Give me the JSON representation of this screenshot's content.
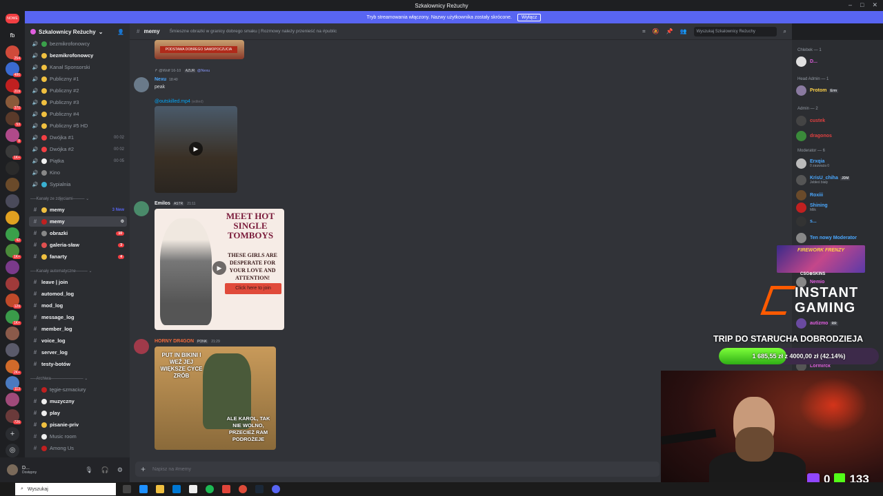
{
  "titlebar": {
    "title": "Szkalownicy Reżuchy"
  },
  "banner": {
    "text": "Tryb streamowania włączony. Nazwy użytkownika zostały skrócone.",
    "button": "Wyłącz"
  },
  "servers": {
    "new_label": "NOWE",
    "new_count": "37",
    "fb": "fb",
    "badges": [
      "254",
      "486",
      "219",
      "370",
      "53",
      "8",
      "1K+",
      "42",
      "1K+",
      "129",
      "1K+",
      "2K+",
      "113",
      "726"
    ]
  },
  "server": {
    "name": "Szkalownicy Reżuchy"
  },
  "channels": [
    {
      "name": "bezmikrofonowcy",
      "type": "voice",
      "style": "dim"
    },
    {
      "name": "bezmikrofonowcy",
      "type": "voice",
      "style": "bright"
    },
    {
      "name": "Kanał Sponsorski",
      "type": "voice",
      "style": "dim"
    },
    {
      "name": "Publiczny #1",
      "type": "voice",
      "style": "dim"
    },
    {
      "name": "Publiczny #2",
      "type": "voice",
      "style": "dim"
    },
    {
      "name": "Publiczny #3",
      "type": "voice",
      "style": "dim"
    },
    {
      "name": "Publiczny #4",
      "type": "voice",
      "style": "dim"
    },
    {
      "name": "Publiczny #5 HD",
      "type": "voice",
      "style": "dim"
    },
    {
      "name": "Dwójka #1",
      "type": "voice",
      "style": "dim",
      "count": "00 02"
    },
    {
      "name": "Dwójka #2",
      "type": "voice",
      "style": "dim",
      "count": "00 02"
    },
    {
      "name": "Piątka",
      "type": "voice",
      "style": "dim",
      "count": "00 05"
    },
    {
      "name": "Kino",
      "type": "voice",
      "style": "dim"
    },
    {
      "name": "Sypialnia",
      "type": "voice",
      "style": "dim"
    }
  ],
  "categories": {
    "photos": "Kanały ze zdjęciami",
    "auto": "Kanały automatyczne",
    "archive": "Archiwa"
  },
  "photo_channels": [
    {
      "name": "memy",
      "badge": "3 New"
    },
    {
      "name": "memy",
      "selected": true
    },
    {
      "name": "obrazki",
      "badge": "10"
    },
    {
      "name": "galeria-sław",
      "badge": "3"
    },
    {
      "name": "fanarty",
      "badge": "4"
    }
  ],
  "auto_channels": [
    "leave | join",
    "automod_log",
    "mod_log",
    "message_log",
    "member_log",
    "voice_log",
    "server_log",
    "testy-botów"
  ],
  "archive_channels": [
    {
      "name": "tęgie-szmaciury",
      "style": "dim"
    },
    {
      "name": "muzyczny",
      "style": "bright"
    },
    {
      "name": "play",
      "style": "bright"
    },
    {
      "name": "pisanie-priv",
      "style": "bright"
    },
    {
      "name": "Music room",
      "style": "dim"
    },
    {
      "name": "Among Us",
      "style": "dim"
    }
  ],
  "user": {
    "name": "D...",
    "status": "Dostępny"
  },
  "channel_header": {
    "name": "memy",
    "topic": "Śmieszne obrazki w granicy dobrego smaku | Rozmowy należy przenieść na #public",
    "search_placeholder": "Wyszukaj Szkalownicy Reżuchy"
  },
  "messages": {
    "m1_reply": "@Wolf 16-10",
    "m1_reply_tag": "AZUR",
    "m1_reply_mention": "@Nexu",
    "m1_author": "Nexu",
    "m1_time": "18:40",
    "m1_text": "peak",
    "m1_attachment": "@outskilled.mp4",
    "m1_attachment_sub": "(edited)",
    "m2_author": "Emilos",
    "m2_tag": "ASTR",
    "m2_time": "21:11",
    "m2_img_title": "MEET HOT SINGLE TOMBOYS",
    "m2_img_sub": "THESE GIRLS ARE DESPERATE FOR YOUR LOVE AND ATTENTION!",
    "m2_img_btn": "Click here to join",
    "m3_author": "HORNY DR4GON",
    "m3_tag": "PONK",
    "m3_time": "21:29",
    "m3_img_top": "PUT IN BIKINI I WEŹ JEJ WIĘKSZE CYCE ZRÓB",
    "m3_img_bottom": "ALE KAROL, TAK NIE WOLNO, PRZECIEŻ RAM PODROŻEJE",
    "m0_banner": "PODSTAWA DOBREGO SAMOPOCZUCIA"
  },
  "composer": {
    "placeholder": "Napisz na #memy"
  },
  "members": {
    "groups": [
      "Chlebek — 1",
      "Head Admin — 1",
      "Admin — 2",
      "Moderator — 6"
    ],
    "list": [
      {
        "name": "D...",
        "color": "#e05ee0"
      },
      {
        "name": "Protom",
        "color": "#ffd34a",
        "tag": "Erm"
      },
      {
        "name": "custek",
        "color": "#e04040"
      },
      {
        "name": "dragonos",
        "color": "#e04040"
      },
      {
        "name": "Erxqia",
        "color": "#4aa8ff",
        "sub": "0 zauważa 0"
      },
      {
        "name": "KrisU_chiha",
        "color": "#4aa8ff",
        "tag": "JDM",
        "sub": "Jebłeś biały"
      },
      {
        "name": "Roxiii",
        "color": "#4aa8ff"
      },
      {
        "name": "Shining",
        "color": "#4aa8ff",
        "sub": "Milk"
      },
      {
        "name": "s...",
        "color": "#4aa8ff"
      },
      {
        "name": "Ten nowy Moderator",
        "color": "#4aa8ff"
      },
      {
        "name": "Nemio",
        "color": "#e05ee0"
      },
      {
        "name": "autizmo",
        "color": "#e05ee0",
        "tag": "RR"
      },
      {
        "name": "Lormirck",
        "color": "#e05ee0"
      }
    ]
  },
  "overlay": {
    "ad_title": "FIREWORK FRENZY",
    "ad_label": "CSG⊕SKINS",
    "ig_line1": "INSTANT",
    "ig_line2": "GAMING",
    "goal_title": "TRIP DO STARUCHA DOBRODZIEJA",
    "goal_text": "1 685,55 zł z 4000,00 zł (42.14%)",
    "goal_fraction": 0.4214,
    "twitch_count": "0",
    "kick_count": "133"
  },
  "taskbar": {
    "search": "Wyszukaj"
  },
  "colors": {
    "accent": "#5865f2",
    "bg": "#313338",
    "sidebar": "#2b2d31"
  }
}
